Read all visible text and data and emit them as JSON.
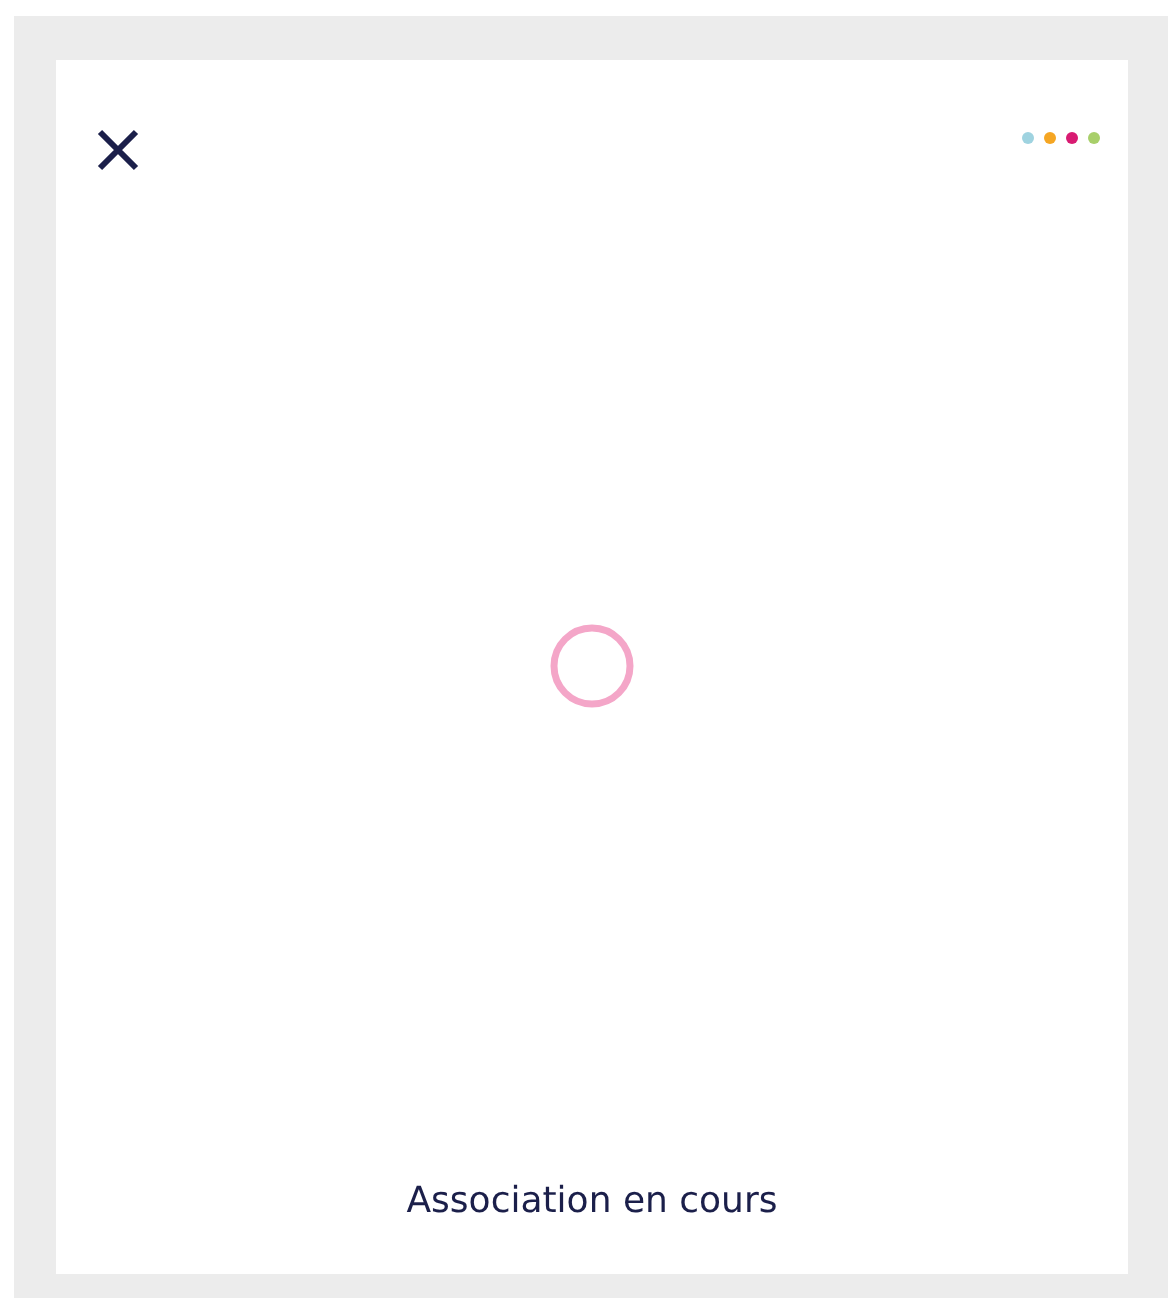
{
  "header": {
    "dots": [
      {
        "color": "#9fd3e0"
      },
      {
        "color": "#f5a623"
      },
      {
        "color": "#d81b72"
      },
      {
        "color": "#a8cf6a"
      }
    ]
  },
  "spinner": {
    "color": "#f4a6c8"
  },
  "status": {
    "text": "Association en cours"
  }
}
